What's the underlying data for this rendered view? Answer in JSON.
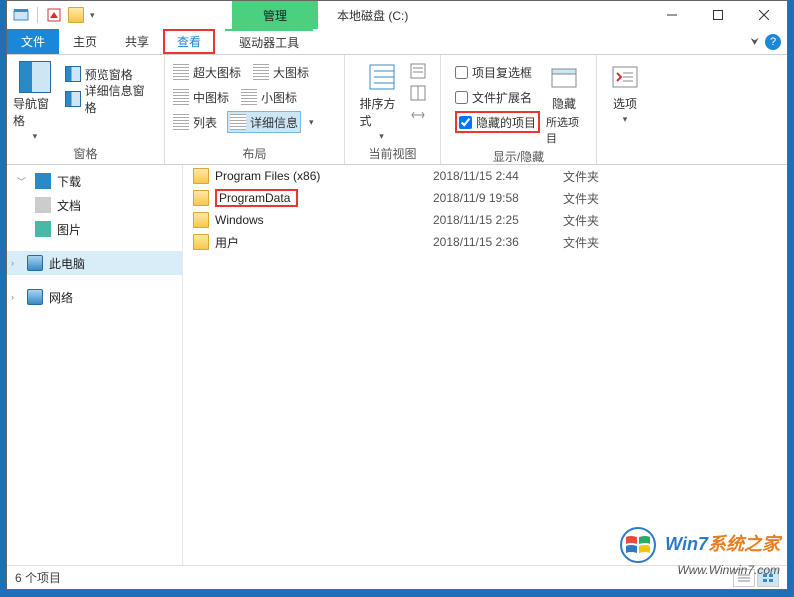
{
  "titlebar": {
    "contextual": "管理",
    "title": "本地磁盘 (C:)"
  },
  "tabs": {
    "file": "文件",
    "home": "主页",
    "share": "共享",
    "view": "查看",
    "drive": "驱动器工具"
  },
  "ribbon": {
    "panes": {
      "nav_pane": "导航窗格",
      "preview": "预览窗格",
      "details": "详细信息窗格",
      "label": "窗格"
    },
    "layout": {
      "xl_icons": "超大图标",
      "l_icons": "大图标",
      "m_icons": "中图标",
      "s_icons": "小图标",
      "list": "列表",
      "details": "详细信息",
      "label": "布局"
    },
    "current_view": {
      "sort": "排序方式",
      "label": "当前视图"
    },
    "show_hide": {
      "item_checkboxes": "项目复选框",
      "file_ext": "文件扩展名",
      "hidden_items": "隐藏的项目",
      "hide": "隐藏",
      "selected": "所选项目",
      "label": "显示/隐藏"
    },
    "options": {
      "options": "选项"
    }
  },
  "nav": {
    "downloads": "下载",
    "documents": "文档",
    "pictures": "图片",
    "this_pc": "此电脑",
    "network": "网络"
  },
  "files": [
    {
      "name": "Program Files (x86)",
      "date": "2018/11/15 2:44",
      "type": "文件夹"
    },
    {
      "name": "ProgramData",
      "date": "2018/11/9 19:58",
      "type": "文件夹",
      "highlight": true
    },
    {
      "name": "Windows",
      "date": "2018/11/15 2:25",
      "type": "文件夹"
    },
    {
      "name": "用户",
      "date": "2018/11/15 2:36",
      "type": "文件夹"
    }
  ],
  "status": {
    "count": "6 个项目"
  },
  "watermark": {
    "brand1": "Win7",
    "brand2": "系统之家",
    "sub": "Www.Winwin7.com"
  }
}
